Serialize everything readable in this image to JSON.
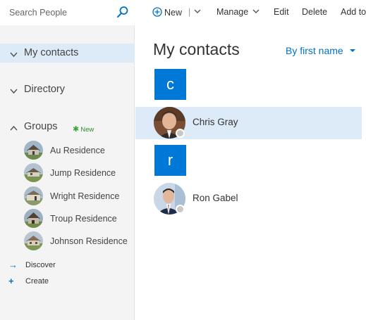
{
  "search": {
    "placeholder": "Search People"
  },
  "toolbar": {
    "new_label": "New",
    "manage_label": "Manage",
    "edit_label": "Edit",
    "delete_label": "Delete",
    "add_to_label": "Add to"
  },
  "sidebar": {
    "my_contacts": "My contacts",
    "directory": "Directory",
    "groups": "Groups",
    "new_badge": "New",
    "groups_list": [
      {
        "label": "Au Residence"
      },
      {
        "label": "Jump Residence"
      },
      {
        "label": "Wright Residence"
      },
      {
        "label": "Troup Residence"
      },
      {
        "label": "Johnson Residence"
      }
    ],
    "discover": "Discover",
    "create": "Create"
  },
  "main": {
    "title": "My contacts",
    "sort_label": "By first name",
    "sections": [
      {
        "letter": "c",
        "contacts": [
          {
            "name": "Chris Gray",
            "selected": true
          }
        ]
      },
      {
        "letter": "r",
        "contacts": [
          {
            "name": "Ron Gabel",
            "selected": false
          }
        ]
      }
    ]
  },
  "colors": {
    "accent": "#0078d7",
    "link": "#0072c6",
    "selection": "#dcebf7",
    "sidebar": "#f4f4f4"
  }
}
